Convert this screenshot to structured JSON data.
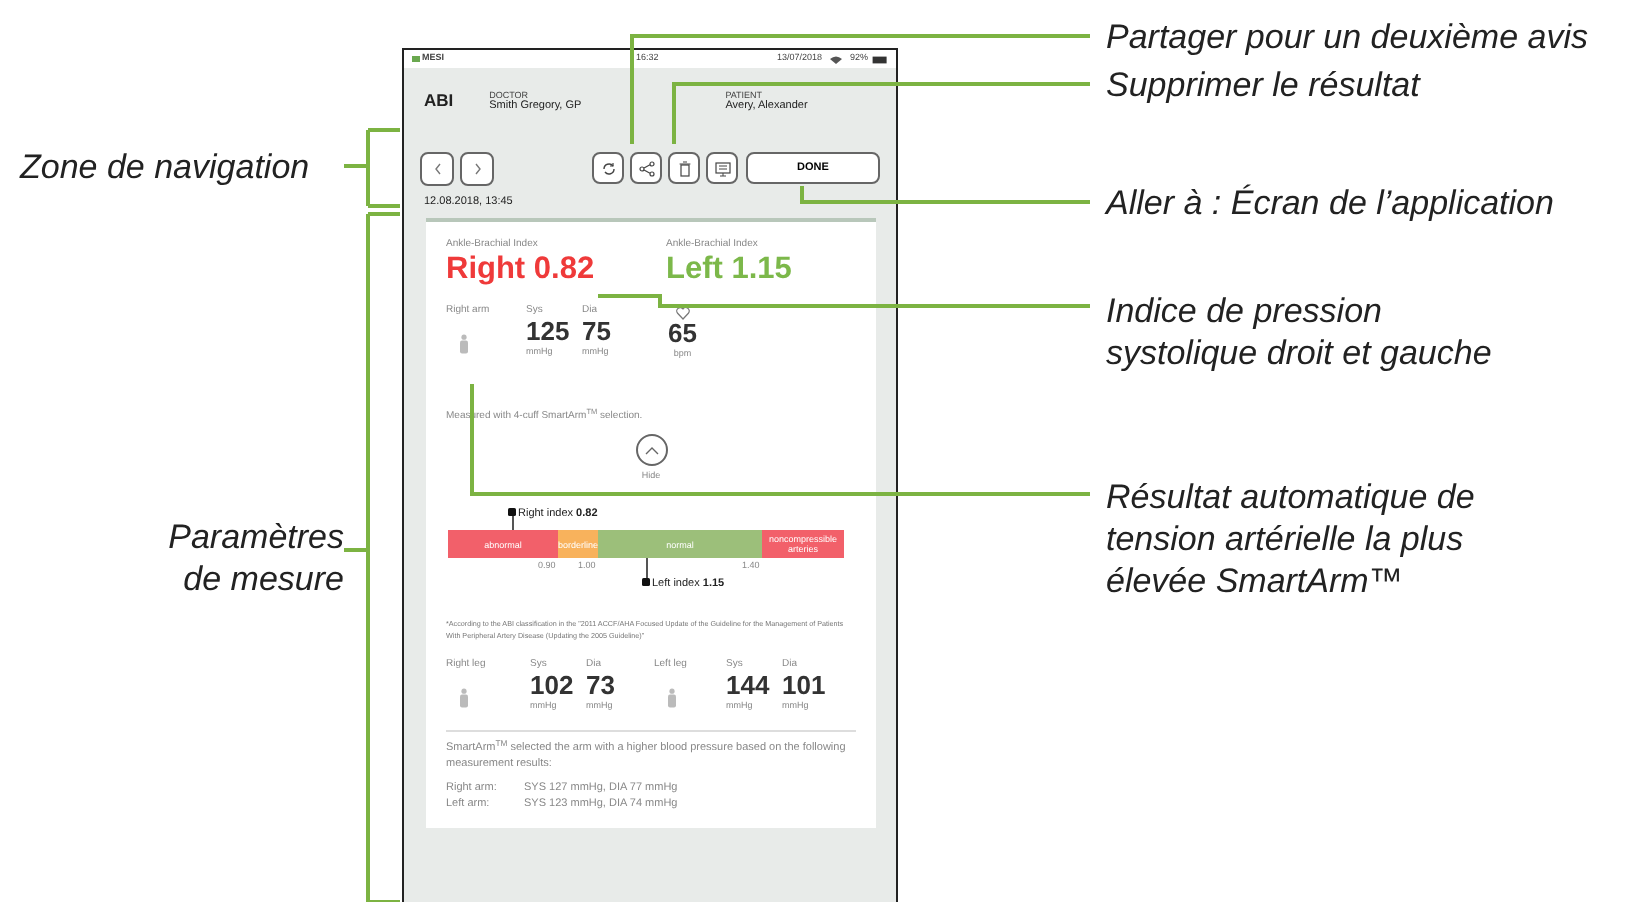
{
  "annotations_left": [
    "Zone de navigation",
    "Paramètres de mesure"
  ],
  "annotations_right": [
    "Partager pour un deuxième avis",
    "Supprimer le résultat",
    "Aller à : Écran de l’application",
    "Indice de pression systolique droit et gauche",
    "Résultat automatique de tension artérielle la plus élevée SmartArm™"
  ],
  "status_bar": {
    "app": "MESI",
    "time": "16:32",
    "date": "13/07/2018",
    "battery": "92%"
  },
  "header": {
    "title": "ABI",
    "doctor_label": "DOCTOR",
    "doctor": "Smith Gregory, GP",
    "patient_label": "PATIENT",
    "patient": "Avery, Alexander"
  },
  "toolbar": {
    "done": "DONE",
    "date": "12.08.2018, 13:45"
  },
  "abi": [
    {
      "label": "Ankle-Brachial Index",
      "value": "Right 0.82",
      "color": "#ef3a3a"
    },
    {
      "label": "Ankle-Brachial Index",
      "value": "Left 1.15",
      "color": "#7cb84a"
    }
  ],
  "arm": {
    "label": "Right arm",
    "sys_label": "Sys",
    "sys": "125",
    "sys_unit": "mmHg",
    "dia_label": "Dia",
    "dia": "75",
    "dia_unit": "mmHg",
    "pulse": "65",
    "pulse_unit": "bpm"
  },
  "note": "Measured with 4-cuff SmartArm$^{TM}$ selection.",
  "hide": "Hide",
  "scale": {
    "segments": [
      {
        "label": "abnormal",
        "color": "#f2606a"
      },
      {
        "label": "borderline",
        "color": "#f8b25c"
      },
      {
        "label": "normal",
        "color": "#9cbf7a"
      },
      {
        "label": "noncompressible arteries",
        "color": "#f2606a"
      }
    ],
    "ticks": [
      "0.90",
      "1.00",
      "1.40"
    ],
    "right_marker": {
      "label": "Right index",
      "value": "0.82"
    },
    "left_marker": {
      "label": "Left index",
      "value": "1.15"
    }
  },
  "footnote": "*According to the ABI classification in the \"2011 ACCF/AHA Focused Update of the Guideline for the Management of Patients With Peripheral Artery Disease (Updating the 2005 Guideline)\"",
  "legs": [
    {
      "label": "Right leg",
      "sys_label": "Sys",
      "sys": "102",
      "sys_unit": "mmHg",
      "dia_label": "Dia",
      "dia": "73",
      "dia_unit": "mmHg"
    },
    {
      "label": "Left leg",
      "sys_label": "Sys",
      "sys": "144",
      "sys_unit": "mmHg",
      "dia_label": "Dia",
      "dia": "101",
      "dia_unit": "mmHg"
    }
  ],
  "summary": "SmartArm$^{TM}$ selected the arm with a higher blood pressure based on the following measurement results:",
  "arm_results": [
    {
      "label": "Right arm:",
      "value": "SYS 127 mmHg, DIA 77 mmHg"
    },
    {
      "label": "Left arm:",
      "value": "SYS 123 mmHg, DIA 74 mmHg"
    }
  ]
}
